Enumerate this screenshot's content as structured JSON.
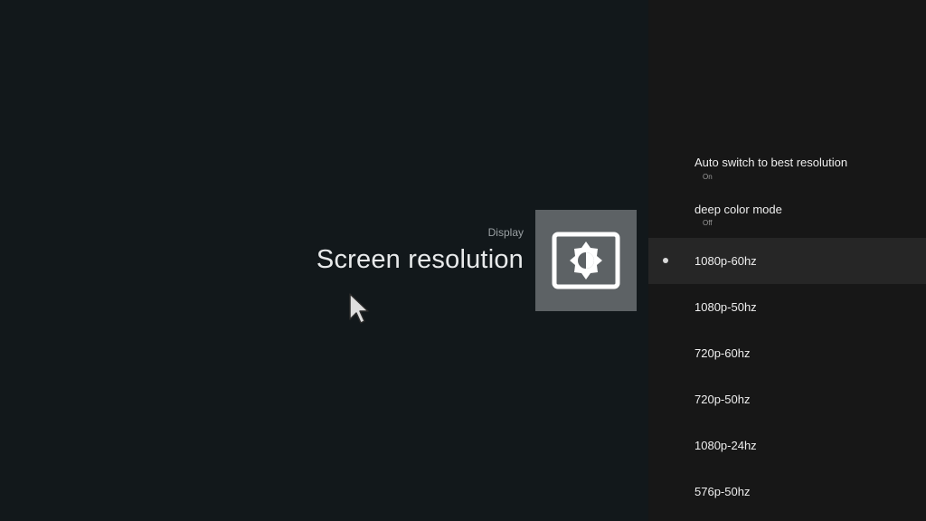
{
  "header": {
    "breadcrumb": "Display",
    "title": "Screen resolution",
    "icon": "display-brightness-icon"
  },
  "settings": {
    "toggles": [
      {
        "label": "Auto switch to best resolution",
        "value": "On"
      },
      {
        "label": "deep color mode",
        "value": "Off"
      }
    ],
    "resolutions": [
      {
        "label": "1080p-60hz",
        "selected": true
      },
      {
        "label": "1080p-50hz",
        "selected": false
      },
      {
        "label": "720p-60hz",
        "selected": false
      },
      {
        "label": "720p-50hz",
        "selected": false
      },
      {
        "label": "1080p-24hz",
        "selected": false
      },
      {
        "label": "576p-50hz",
        "selected": false
      }
    ]
  },
  "colors": {
    "left_background": "#12181b",
    "right_background": "#171717",
    "selected_row": "#262626",
    "icon_tile": "#5d6265"
  }
}
